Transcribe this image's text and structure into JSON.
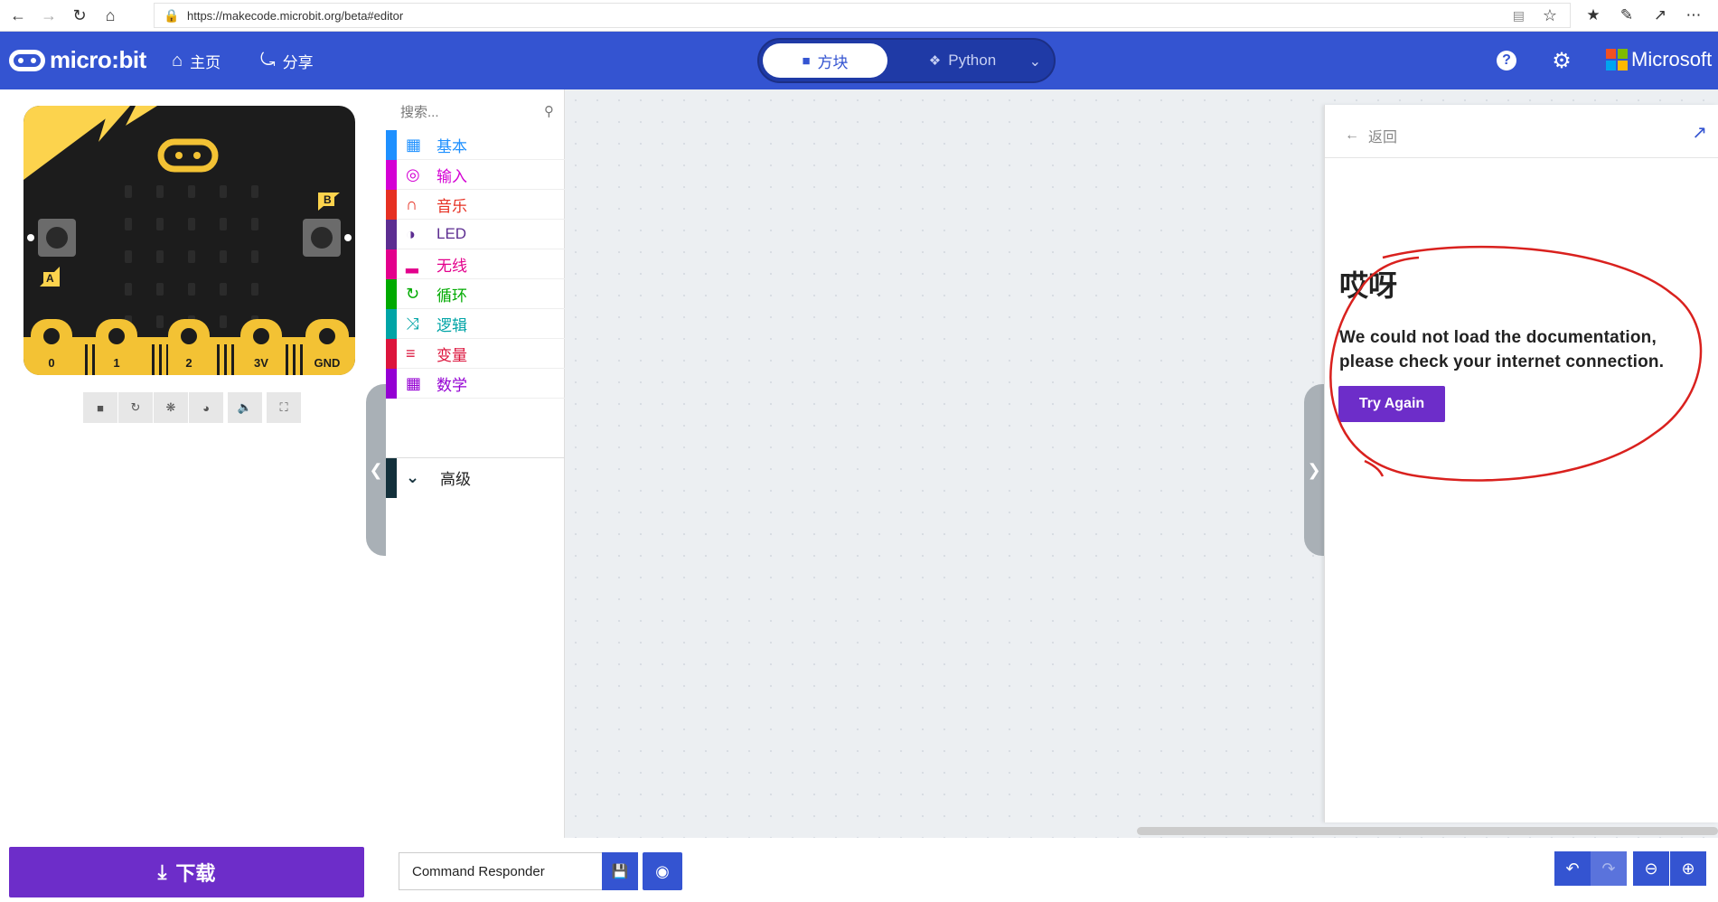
{
  "browser": {
    "url": "https://makecode.microbit.org/beta#editor"
  },
  "header": {
    "logo_text": "micro:bit",
    "home_label": "主页",
    "share_label": "分享",
    "mode_tabs": {
      "blocks": "方块",
      "python": "Python"
    },
    "microsoft_label": "Microsoft",
    "help_glyph": "?"
  },
  "colors": {
    "header_bg": "#3454d1",
    "download_bg": "#6d2dc9",
    "annotation": "#d9211e"
  },
  "simulator": {
    "pin_labels": [
      "0",
      "1",
      "2",
      "3V",
      "GND"
    ],
    "button_a": "A",
    "button_b": "B",
    "toolbar_icons": [
      "stop-icon",
      "restart-icon",
      "debug-icon",
      "slowmo-icon",
      "mute-icon",
      "fullscreen-icon"
    ]
  },
  "download_label": "下载",
  "toolbox": {
    "search_placeholder": "搜索...",
    "categories": [
      {
        "label": "基本",
        "color": "#1e90ff",
        "icon": "grid-icon"
      },
      {
        "label": "输入",
        "color": "#d400d4",
        "icon": "target-icon"
      },
      {
        "label": "音乐",
        "color": "#e63022",
        "icon": "headphones-icon"
      },
      {
        "label": "LED",
        "color": "#5c2d91",
        "icon": "toggle-icon"
      },
      {
        "label": "无线",
        "color": "#e3008c",
        "icon": "signal-icon"
      },
      {
        "label": "循环",
        "color": "#00aa00",
        "icon": "refresh-icon"
      },
      {
        "label": "逻辑",
        "color": "#00a4a6",
        "icon": "shuffle-icon"
      },
      {
        "label": "变量",
        "color": "#dc143c",
        "icon": "list-icon"
      },
      {
        "label": "数学",
        "color": "#9400d3",
        "icon": "calculator-icon"
      }
    ],
    "advanced_label": "高级"
  },
  "docs": {
    "back_label": "返回",
    "title": "哎呀",
    "message": "We could not load the documentation, please check your internet connection.",
    "try_again": "Try Again"
  },
  "bottombar": {
    "project_name": "Command Responder"
  }
}
